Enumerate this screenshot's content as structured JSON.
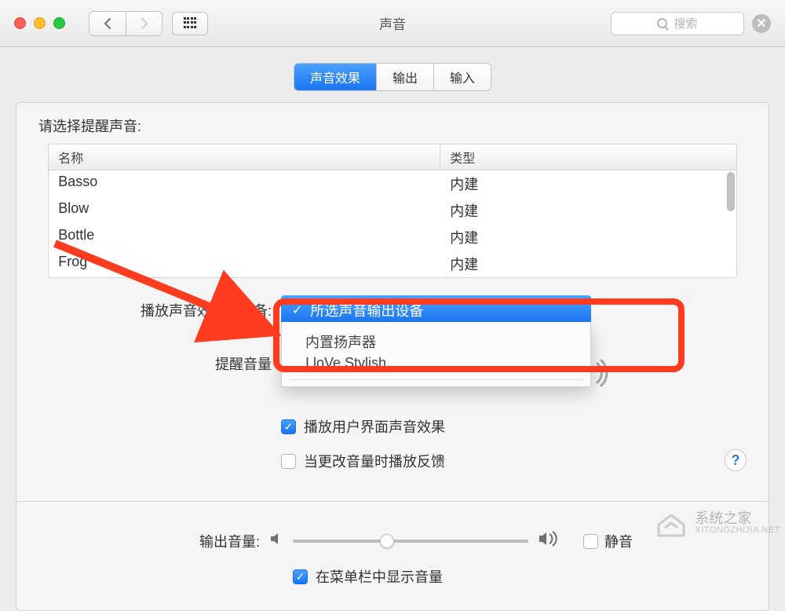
{
  "window": {
    "title": "声音",
    "search_placeholder": "搜索"
  },
  "tabs": {
    "effects": "声音效果",
    "output": "输出",
    "input": "输入",
    "active": "effects"
  },
  "alert_sound": {
    "section_label": "请选择提醒声音:",
    "columns": {
      "name": "名称",
      "type": "类型"
    },
    "rows": [
      {
        "name": "Basso",
        "type": "内建"
      },
      {
        "name": "Blow",
        "type": "内建"
      },
      {
        "name": "Bottle",
        "type": "内建"
      },
      {
        "name": "Frog",
        "type": "内建"
      }
    ]
  },
  "device_row": {
    "label": "播放声音效果的设备:",
    "selected": "所选声音输出设备",
    "options": [
      "内置扬声器",
      "I loVe Stylish"
    ]
  },
  "alert_volume": {
    "label": "提醒音量"
  },
  "checkboxes": {
    "ui_sound_effects": {
      "label": "播放用户界面声音效果",
      "checked": true
    },
    "feedback_on_volume_change": {
      "label": "当更改音量时播放反馈",
      "checked": false
    }
  },
  "output_volume": {
    "label": "输出音量:",
    "mute_label": "静音",
    "mute_checked": false,
    "position_percent": 40
  },
  "show_in_menu_bar": {
    "label": "在菜单栏中显示音量",
    "checked": true
  },
  "watermark": {
    "name": "系统之家",
    "sub": "XITONGZHIJIA.NET"
  },
  "colors": {
    "accent": "#1f7cf4",
    "annotation": "#ff3b20"
  }
}
